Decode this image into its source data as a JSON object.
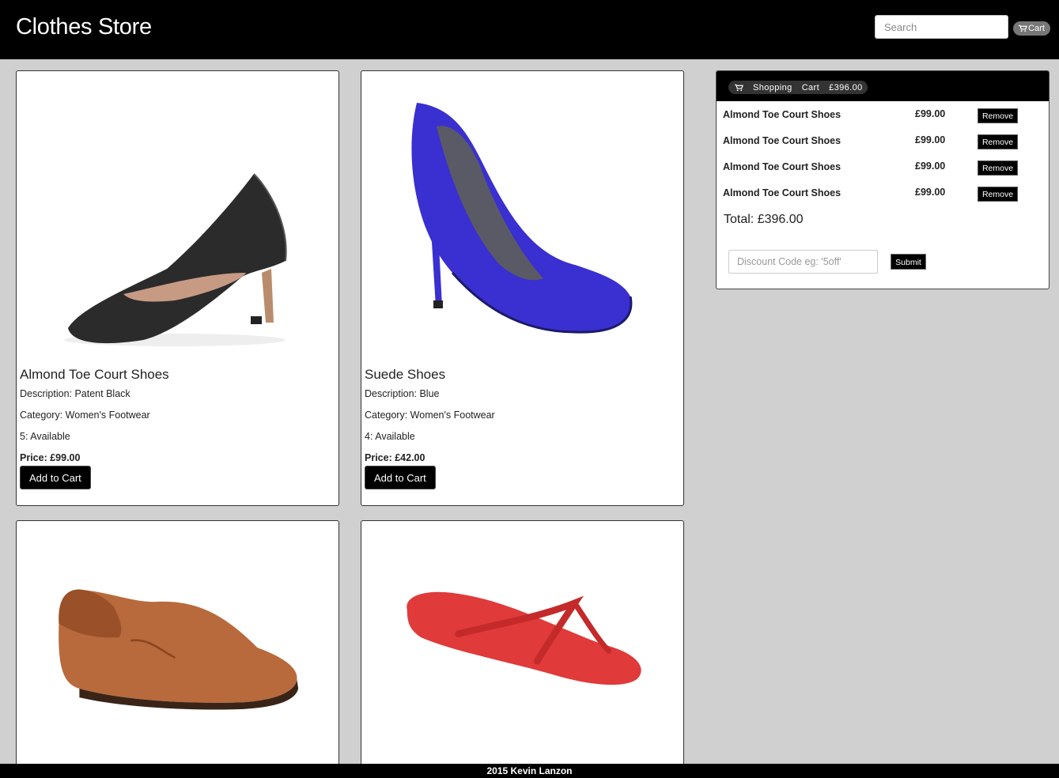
{
  "header": {
    "brand": "Clothes Store",
    "search_placeholder": "Search",
    "cart_label": "Cart"
  },
  "products": [
    {
      "image_icon": "black-court-shoe-image",
      "name": "Almond Toe Court Shoes",
      "description": "Description: Patent Black",
      "category": "Category: Women's Footwear",
      "stock": "5: Available",
      "price": "Price: £99.00",
      "add_label": "Add to Cart"
    },
    {
      "image_icon": "blue-suede-shoe-image",
      "name": "Suede Shoes",
      "description": "Description: Blue",
      "category": "Category: Women's Footwear",
      "stock": "4: Available",
      "price": "Price: £42.00",
      "add_label": "Add to Cart"
    },
    {
      "image_icon": "brown-loafer-image"
    },
    {
      "image_icon": "red-flip-flop-image"
    }
  ],
  "cart": {
    "heading_word1": "Shopping",
    "heading_word2": "Cart",
    "heading_amount": "£396.00",
    "items": [
      {
        "name": "Almond Toe Court Shoes",
        "price": "£99.00",
        "remove_label": "Remove"
      },
      {
        "name": "Almond Toe Court Shoes",
        "price": "£99.00",
        "remove_label": "Remove"
      },
      {
        "name": "Almond Toe Court Shoes",
        "price": "£99.00",
        "remove_label": "Remove"
      },
      {
        "name": "Almond Toe Court Shoes",
        "price": "£99.00",
        "remove_label": "Remove"
      }
    ],
    "total": "Total: £396.00",
    "discount_placeholder": "Discount Code eg: '5off'",
    "submit_label": "Submit"
  },
  "footer": {
    "text": "2015 Kevin Lanzon"
  },
  "colors": {
    "header_bg": "#000000",
    "page_bg": "#d0d0d0",
    "button_bg": "#000000",
    "blue_shoe": "#3a2fd0",
    "red_flipflop": "#e03a3a",
    "loafer": "#b86a3c"
  }
}
